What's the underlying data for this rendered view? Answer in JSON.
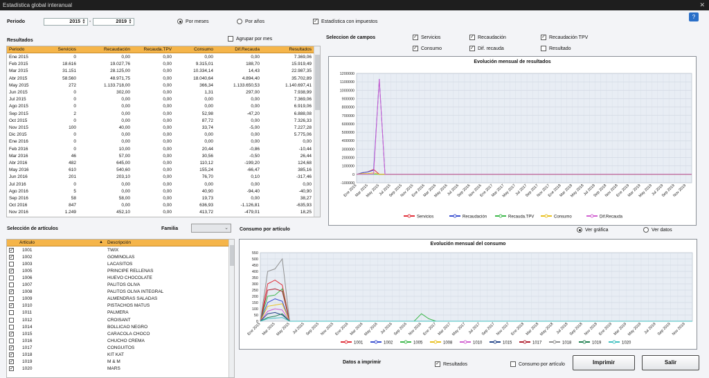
{
  "window": {
    "title": "Estadística global interanual",
    "close": "✕"
  },
  "periodo": {
    "label": "Periodo",
    "from": "2015",
    "sep": "-",
    "to": "2019"
  },
  "mode": {
    "meses": "Por meses",
    "anos": "Por años",
    "meses_selected": true
  },
  "impuestos": {
    "label": "Estadística con impuestos",
    "checked": true
  },
  "resultados": {
    "title": "Resultados",
    "agrupar": "Agrupar por mes",
    "columns": [
      "Periodo",
      "Servicios",
      "Recaudación",
      "Recauda.TPV",
      "Consumo",
      "Dif.Recauda",
      "Resultados"
    ],
    "rows": [
      [
        "Ene 2015",
        "0",
        "0,00",
        "0,00",
        "0,00",
        "0,00",
        "7.369,06"
      ],
      [
        "Feb 2015",
        "18.616",
        "19.027,76",
        "0,00",
        "9.315,01",
        "188,70",
        "15.919,49"
      ],
      [
        "Mar 2015",
        "31.151",
        "28.125,00",
        "0,00",
        "10.334,14",
        "14,43",
        "22.987,35"
      ],
      [
        "Abr 2015",
        "58.560",
        "48.971,75",
        "0,00",
        "18.040,64",
        "4.894,40",
        "35.702,89"
      ],
      [
        "May 2015",
        "272",
        "1.133.718,00",
        "0,00",
        "366,34",
        "1.133.650,53",
        "1.140.697,41"
      ],
      [
        "Jun 2015",
        "0",
        "302,00",
        "0,00",
        "1,31",
        "297,00",
        "7.938,99"
      ],
      [
        "Jul 2015",
        "0",
        "0,00",
        "0,00",
        "0,00",
        "0,00",
        "7.369,06"
      ],
      [
        "Ago 2015",
        "0",
        "0,00",
        "0,00",
        "0,00",
        "0,00",
        "6.919,06"
      ],
      [
        "Sep 2015",
        "2",
        "0,00",
        "0,00",
        "52,98",
        "-47,20",
        "6.888,08"
      ],
      [
        "Oct 2015",
        "0",
        "0,00",
        "0,00",
        "87,72",
        "0,00",
        "7.326,33"
      ],
      [
        "Nov 2015",
        "100",
        "40,00",
        "0,00",
        "33,74",
        "-5,00",
        "7.227,28"
      ],
      [
        "Dic 2015",
        "0",
        "0,00",
        "0,00",
        "0,00",
        "0,00",
        "5.775,06"
      ],
      [
        "Ene 2016",
        "0",
        "0,00",
        "0,00",
        "0,00",
        "0,00",
        "0,00"
      ],
      [
        "Feb 2016",
        "0",
        "10,00",
        "0,00",
        "20,44",
        "-0,86",
        "-10,44"
      ],
      [
        "Mar 2016",
        "46",
        "57,00",
        "0,00",
        "30,56",
        "-0,50",
        "26,44"
      ],
      [
        "Abr 2016",
        "482",
        "645,00",
        "0,00",
        "110,12",
        "-199,20",
        "124,68"
      ],
      [
        "May 2016",
        "610",
        "540,60",
        "0,00",
        "155,24",
        "-66,47",
        "385,16"
      ],
      [
        "Jun 2016",
        "201",
        "203,10",
        "0,00",
        "76,70",
        "0,10",
        "-317,46"
      ],
      [
        "Jul 2016",
        "0",
        "0,00",
        "0,00",
        "0,00",
        "0,00",
        "0,00"
      ],
      [
        "Ago 2016",
        "5",
        "0,00",
        "0,00",
        "40,90",
        "-94,40",
        "-40,90"
      ],
      [
        "Sep 2016",
        "58",
        "58,00",
        "0,00",
        "19,73",
        "0,00",
        "38,27"
      ],
      [
        "Oct 2016",
        "847",
        "0,00",
        "0,00",
        "636,93",
        "-1.126,81",
        "-635,93"
      ],
      [
        "Nov 2016",
        "1.249",
        "452,10",
        "0,00",
        "413,72",
        "-479,01",
        "18,25"
      ]
    ]
  },
  "campos": {
    "title": "Seleccion de campos",
    "items": [
      {
        "label": "Servicios",
        "checked": true
      },
      {
        "label": "Recaudación",
        "checked": true
      },
      {
        "label": "Recaudación TPV",
        "checked": true
      },
      {
        "label": "Consumo",
        "checked": true
      },
      {
        "label": "Dif. recauda",
        "checked": true
      },
      {
        "label": "Resultado",
        "checked": false
      }
    ]
  },
  "articulos": {
    "title": "Selección de artículos",
    "familia": "Familia",
    "columns": [
      "Artículo",
      "Descripción"
    ],
    "rows": [
      {
        "code": "1001",
        "desc": "TWIX",
        "checked": true
      },
      {
        "code": "1002",
        "desc": "GOMINOLAS",
        "checked": true
      },
      {
        "code": "1003",
        "desc": "LACASITOS",
        "checked": false
      },
      {
        "code": "1005",
        "desc": "PRINCIPE RELLENAS",
        "checked": true
      },
      {
        "code": "1006",
        "desc": "HUEVO CHOCOLATE",
        "checked": false
      },
      {
        "code": "1007",
        "desc": "PALITOS OLIVA",
        "checked": false
      },
      {
        "code": "1008",
        "desc": "PALITOS OLIVA INTEGRAL",
        "checked": true
      },
      {
        "code": "1009",
        "desc": "ALMENDRAS SALADAS",
        "checked": false
      },
      {
        "code": "1010",
        "desc": "PISTACHOS MATUS",
        "checked": true
      },
      {
        "code": "1011",
        "desc": "PALMERA",
        "checked": false
      },
      {
        "code": "1012",
        "desc": "CROISANT",
        "checked": false
      },
      {
        "code": "1014",
        "desc": "BOLLICAO NEGRO",
        "checked": false
      },
      {
        "code": "1015",
        "desc": "CARACOLA CHOCO",
        "checked": true
      },
      {
        "code": "1016",
        "desc": "CHUCHO CREMA",
        "checked": false
      },
      {
        "code": "1017",
        "desc": "CONGUITOS",
        "checked": true
      },
      {
        "code": "1018",
        "desc": "KIT KAT",
        "checked": true
      },
      {
        "code": "1019",
        "desc": "M & M",
        "checked": true
      },
      {
        "code": "1020",
        "desc": "MARS",
        "checked": true
      }
    ]
  },
  "consumo": {
    "title": "Consumo por artículo",
    "ver_grafica": "Ver gráfica",
    "ver_datos": "Ver datos"
  },
  "imprimir": {
    "label": "Datos a imprimir",
    "resultados": "Resultados",
    "consumo": "Consumo por artículo",
    "print_btn": "Imprimir",
    "exit_btn": "Salir"
  },
  "colors": {
    "header": "#f5b54a",
    "Servicios": "#e0303a",
    "Recaudación": "#3a4fd0",
    "Recauda.TPV": "#3cb84a",
    "Consumo": "#e8c020",
    "Dif.Recauda": "#d060d0"
  },
  "chart_data": [
    {
      "type": "line",
      "title": "Evolución mensual de resultados",
      "yticks": [
        1200000,
        1100000,
        1000000,
        900000,
        800000,
        700000,
        600000,
        500000,
        400000,
        300000,
        200000,
        100000,
        0,
        -100000
      ],
      "ylim": [
        -100000,
        1200000
      ],
      "x": [
        "Ene 2015",
        "Mar 2015",
        "May 2015",
        "Jul 2015",
        "Sep 2015",
        "Nov 2015",
        "Ene 2016",
        "Mar 2016",
        "May 2016",
        "Jul 2016",
        "Sep 2016",
        "Nov 2016",
        "Ene 2017",
        "Mar 2017",
        "May 2017",
        "Jul 2017",
        "Sep 2017",
        "Nov 2017",
        "Ene 2018",
        "Mar 2018",
        "May 2018",
        "Jul 2018",
        "Sep 2018",
        "Nov 2018",
        "Ene 2019",
        "Mar 2019",
        "May 2019",
        "Jul 2019",
        "Sep 2019",
        "Nov 2019"
      ],
      "series": [
        {
          "name": "Servicios",
          "color": "#e0303a",
          "points": [
            [
              0,
              0
            ],
            [
              1,
              18616
            ],
            [
              2,
              31151
            ],
            [
              3,
              58560
            ],
            [
              4,
              272
            ],
            [
              5,
              0
            ],
            [
              59,
              0
            ]
          ]
        },
        {
          "name": "Recaudación",
          "color": "#3a4fd0",
          "points": [
            [
              0,
              0
            ],
            [
              1,
              19028
            ],
            [
              2,
              28125
            ],
            [
              3,
              48972
            ],
            [
              4,
              1133718
            ],
            [
              5,
              302
            ],
            [
              6,
              0
            ],
            [
              59,
              0
            ]
          ]
        },
        {
          "name": "Recauda.TPV",
          "color": "#3cb84a",
          "points": [
            [
              0,
              0
            ],
            [
              59,
              0
            ]
          ]
        },
        {
          "name": "Consumo",
          "color": "#e8c020",
          "points": [
            [
              0,
              0
            ],
            [
              1,
              9315
            ],
            [
              2,
              10334
            ],
            [
              3,
              18041
            ],
            [
              4,
              366
            ],
            [
              5,
              1
            ],
            [
              59,
              0
            ]
          ]
        },
        {
          "name": "Dif.Recauda",
          "color": "#d060d0",
          "points": [
            [
              0,
              0
            ],
            [
              1,
              189
            ],
            [
              2,
              14
            ],
            [
              3,
              4894
            ],
            [
              4,
              1133651
            ],
            [
              5,
              297
            ],
            [
              6,
              0
            ],
            [
              59,
              0
            ]
          ]
        }
      ]
    },
    {
      "type": "line",
      "title": "Evolución mensual del consumo",
      "yticks": [
        550,
        500,
        450,
        400,
        350,
        300,
        250,
        200,
        150,
        100,
        50,
        0
      ],
      "ylim": [
        0,
        550
      ],
      "x": [
        "Ene 2015",
        "Mar 2015",
        "May 2015",
        "Jul 2015",
        "Sep 2015",
        "Nov 2015",
        "Ene 2016",
        "Mar 2016",
        "May 2016",
        "Jul 2016",
        "Sep 2016",
        "Nov 2016",
        "Ene 2017",
        "Mar 2017",
        "May 2017",
        "Jul 2017",
        "Sep 2017",
        "Nov 2017",
        "Ene 2018",
        "Mar 2018",
        "May 2018",
        "Jul 2018",
        "Sep 2018",
        "Nov 2018",
        "Ene 2019",
        "Mar 2019",
        "May 2019",
        "Jul 2019",
        "Sep 2019",
        "Nov 2019"
      ],
      "series": [
        {
          "name": "1001",
          "color": "#e0303a",
          "points": [
            [
              0,
              0
            ],
            [
              1,
              300
            ],
            [
              2,
              330
            ],
            [
              3,
              290
            ],
            [
              4,
              0
            ],
            [
              59,
              0
            ]
          ]
        },
        {
          "name": "1002",
          "color": "#3a4fd0",
          "points": [
            [
              0,
              0
            ],
            [
              1,
              150
            ],
            [
              2,
              180
            ],
            [
              3,
              160
            ],
            [
              4,
              0
            ],
            [
              59,
              0
            ]
          ]
        },
        {
          "name": "1005",
          "color": "#3cb84a",
          "points": [
            [
              0,
              0
            ],
            [
              1,
              200
            ],
            [
              2,
              210
            ],
            [
              3,
              260
            ],
            [
              4,
              0
            ],
            [
              21,
              0
            ],
            [
              22,
              60
            ],
            [
              23,
              20
            ],
            [
              24,
              0
            ],
            [
              59,
              0
            ]
          ]
        },
        {
          "name": "1008",
          "color": "#e8c020",
          "points": [
            [
              0,
              0
            ],
            [
              1,
              120
            ],
            [
              2,
              130
            ],
            [
              3,
              140
            ],
            [
              4,
              0
            ],
            [
              59,
              0
            ]
          ]
        },
        {
          "name": "1010",
          "color": "#d060d0",
          "points": [
            [
              0,
              0
            ],
            [
              1,
              80
            ],
            [
              2,
              100
            ],
            [
              3,
              90
            ],
            [
              4,
              0
            ],
            [
              59,
              0
            ]
          ]
        },
        {
          "name": "1015",
          "color": "#224488",
          "points": [
            [
              0,
              0
            ],
            [
              1,
              60
            ],
            [
              2,
              70
            ],
            [
              3,
              50
            ],
            [
              4,
              0
            ],
            [
              59,
              0
            ]
          ]
        },
        {
          "name": "1017",
          "color": "#b02030",
          "points": [
            [
              0,
              0
            ],
            [
              1,
              250
            ],
            [
              2,
              260
            ],
            [
              3,
              240
            ],
            [
              4,
              0
            ],
            [
              59,
              0
            ]
          ]
        },
        {
          "name": "1018",
          "color": "#909090",
          "points": [
            [
              0,
              0
            ],
            [
              1,
              400
            ],
            [
              2,
              420
            ],
            [
              3,
              500
            ],
            [
              4,
              0
            ],
            [
              59,
              0
            ]
          ]
        },
        {
          "name": "1019",
          "color": "#208050",
          "points": [
            [
              0,
              0
            ],
            [
              1,
              30
            ],
            [
              2,
              40
            ],
            [
              3,
              60
            ],
            [
              4,
              0
            ],
            [
              59,
              0
            ]
          ]
        },
        {
          "name": "1020",
          "color": "#40c0c0",
          "points": [
            [
              0,
              0
            ],
            [
              1,
              20
            ],
            [
              2,
              25
            ],
            [
              3,
              30
            ],
            [
              4,
              0
            ],
            [
              59,
              0
            ]
          ]
        }
      ]
    }
  ]
}
